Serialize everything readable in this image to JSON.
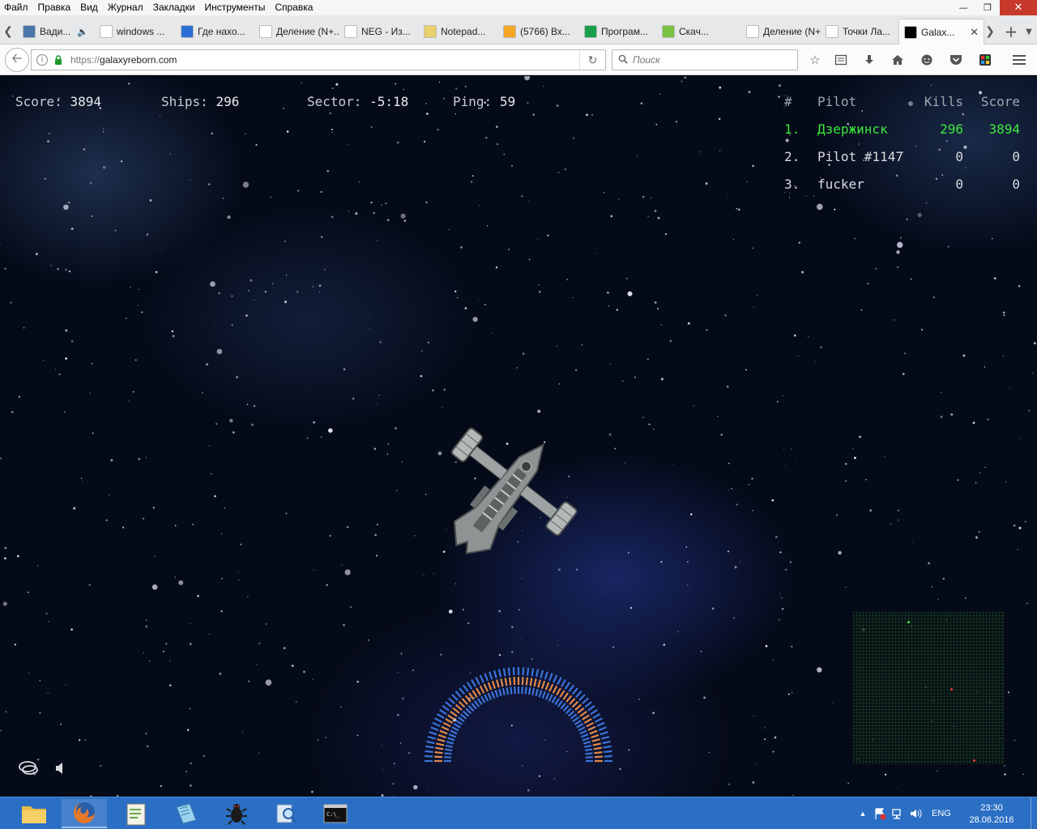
{
  "menu": [
    "Файл",
    "Правка",
    "Вид",
    "Журнал",
    "Закладки",
    "Инструменты",
    "Справка"
  ],
  "tabs": [
    {
      "label": "Вади...",
      "icon": "vk-icon",
      "color": "#4a76a8",
      "extra": "speaker-icon"
    },
    {
      "label": "windows ...",
      "icon": "google-icon",
      "color": "#ffffff"
    },
    {
      "label": "Где нахо...",
      "icon": "document-icon",
      "color": "#2a6fd6"
    },
    {
      "label": "Деление (N+...",
      "icon": "blank-page-icon",
      "color": "#ffffff"
    },
    {
      "label": "NEG - Из...",
      "icon": "neg-icon",
      "color": "#ffffff"
    },
    {
      "label": "Notepad...",
      "icon": "notepad-icon",
      "color": "#e8d16a"
    },
    {
      "label": "(5766) Вх...",
      "icon": "mail-icon",
      "color": "#f5a623"
    },
    {
      "label": "Програм...",
      "icon": "ks-icon",
      "color": "#19a04a"
    },
    {
      "label": "Скач...",
      "icon": "download-site-icon",
      "color": "#7cc242"
    },
    {
      "label": "Деление (N+...",
      "icon": "blank-page-icon",
      "color": "#ffffff"
    },
    {
      "label": "Точки Ла...",
      "icon": "wikipedia-icon",
      "color": "#ffffff"
    },
    {
      "label": "Galax...",
      "icon": "galaxy-icon",
      "color": "#000000"
    }
  ],
  "address": {
    "scheme": "https://",
    "host": "galaxyreborn.com"
  },
  "search": {
    "placeholder": "Поиск"
  },
  "hud": {
    "score_label": "Score:",
    "score": "3894",
    "ships_label": "Ships:",
    "ships": "296",
    "sector_label": "Sector:",
    "sector": "-5:18",
    "ping_label": "Ping:",
    "ping": "59"
  },
  "leaderboard": {
    "headers": {
      "num": "#",
      "pilot": "Pilot",
      "kills": "Kills",
      "score": "Score"
    },
    "rows": [
      {
        "num": "1.",
        "pilot": "Дзержинск",
        "kills": "296",
        "score": "3894",
        "self": true
      },
      {
        "num": "2.",
        "pilot": "Pilot #1147",
        "kills": "0",
        "score": "0",
        "self": false
      },
      {
        "num": "3.",
        "pilot": "fucker",
        "kills": "0",
        "score": "0",
        "self": false
      }
    ]
  },
  "colors": {
    "self": "#3ee63e",
    "hud_text": "#c8cdd4",
    "gauge_blue": "#3c74d8",
    "gauge_orange": "#e0894a",
    "taskbar": "#2b6fc4"
  },
  "tray": {
    "lang": "ENG",
    "time": "23:30",
    "date": "28.06.2016"
  }
}
